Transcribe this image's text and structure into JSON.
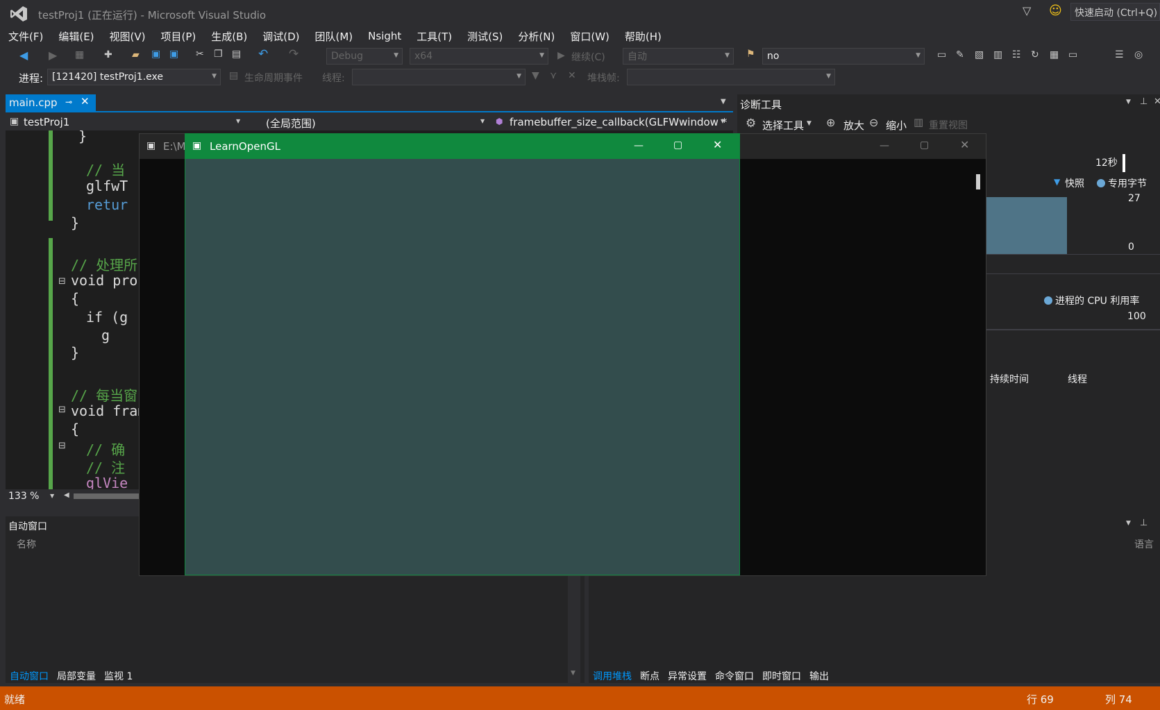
{
  "titlebar": {
    "title": "testProj1 (正在运行) - Microsoft Visual Studio",
    "quick_launch": "快速启动 (Ctrl+Q)"
  },
  "menu": [
    "文件(F)",
    "编辑(E)",
    "视图(V)",
    "项目(P)",
    "生成(B)",
    "调试(D)",
    "团队(M)",
    "Nsight",
    "工具(T)",
    "测试(S)",
    "分析(N)",
    "窗口(W)",
    "帮助(H)"
  ],
  "toolbar": {
    "config": "Debug",
    "platform": "x64",
    "continue": "继续(C)",
    "auto": "自动",
    "target": "no"
  },
  "debug_bar": {
    "process_label": "进程:",
    "process_value": "[121420] testProj1.exe",
    "lifecycle": "生命周期事件",
    "thread_label": "线程:",
    "stack_label": "堆栈帧:"
  },
  "editor": {
    "tab": "main.cpp",
    "nav_project": "testProj1",
    "nav_scope": "(全局范围)",
    "nav_function": "framebuffer_size_callback(GLFWwindow *",
    "zoom": "133 %",
    "lines": [
      {
        "text": "}",
        "color": "#dcdcdc",
        "indent": 1
      },
      {
        "text": "// 当",
        "color": "#57a64a",
        "indent": 2
      },
      {
        "text": "glfwT",
        "color": "#dcdcdc",
        "indent": 2
      },
      {
        "text": "retur",
        "color": "#569cd6",
        "indent": 2
      },
      {
        "text": "}",
        "color": "#dcdcdc",
        "indent": 0
      },
      {
        "text": "// 处理所",
        "color": "#57a64a",
        "indent": 0
      },
      {
        "text": "void proc",
        "color": "#dcdcdc",
        "indent": 0
      },
      {
        "text": "{",
        "color": "#dcdcdc",
        "indent": 0
      },
      {
        "text": "if (g",
        "color": "#dcdcdc",
        "indent": 2
      },
      {
        "text": "g",
        "color": "#dcdcdc",
        "indent": 4
      },
      {
        "text": "}",
        "color": "#dcdcdc",
        "indent": 0
      },
      {
        "text": "// 每当窗",
        "color": "#57a64a",
        "indent": 0
      },
      {
        "text": "void fram",
        "color": "#dcdcdc",
        "indent": 0
      },
      {
        "text": "{",
        "color": "#dcdcdc",
        "indent": 0
      },
      {
        "text": "// 确",
        "color": "#57a64a",
        "indent": 2
      },
      {
        "text": "// 注",
        "color": "#57a64a",
        "indent": 2
      },
      {
        "text": "glVie",
        "color": "#c586c0",
        "indent": 2
      }
    ]
  },
  "diagnostics": {
    "title": "诊断工具",
    "select_tools": "选择工具",
    "zoom_in": "放大",
    "zoom_out": "缩小",
    "reset_view": "重置视图",
    "time": "12秒",
    "snapshot": "快照",
    "private_bytes": "专用字节",
    "mem_max": "27",
    "mem_min": "0",
    "cpu_legend": "进程的 CPU 利用率",
    "cpu_max": "100",
    "col_duration": "持续时间",
    "col_thread": "线程",
    "col_language": "语言"
  },
  "autos": {
    "title": "自动窗口",
    "col_name": "名称",
    "tabs": [
      "自动窗口",
      "局部变量",
      "监视 1"
    ]
  },
  "callstack": {
    "tabs": [
      "调用堆栈",
      "断点",
      "异常设置",
      "命令窗口",
      "即时窗口",
      "输出"
    ]
  },
  "console_window": {
    "title": "E:\\M"
  },
  "gl_window": {
    "title": "LearnOpenGL"
  },
  "statusbar": {
    "text": "就绪",
    "line": "行 69",
    "col": "列 74"
  },
  "colors": {
    "accent": "#007acc",
    "status": "#ca5100",
    "gl_title": "#10893e",
    "gl_clear": "#334d4d"
  }
}
